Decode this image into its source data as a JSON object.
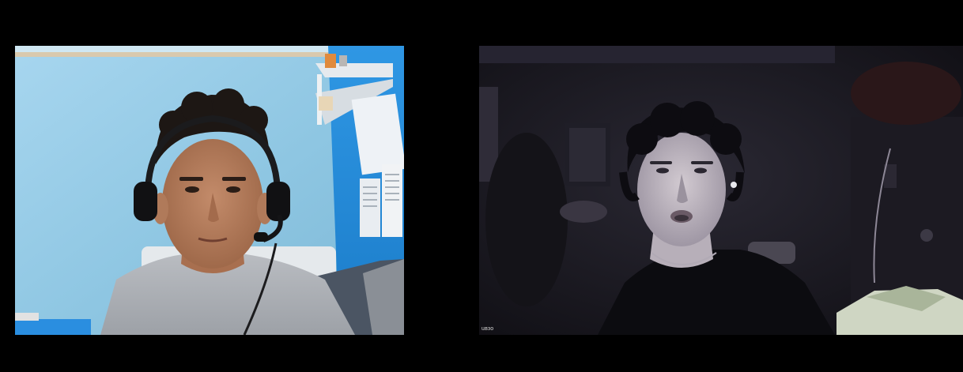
{
  "call": {
    "participants": [
      {
        "id": "participant-1",
        "label": "",
        "camera_on": true
      },
      {
        "id": "participant-2",
        "label": "uвзо",
        "camera_on": true
      }
    ]
  },
  "colors": {
    "background": "#000000",
    "left_wall": "#8ec6e2",
    "left_accent_wall": "#1e86d6",
    "right_room": "#17161d"
  },
  "icons": []
}
